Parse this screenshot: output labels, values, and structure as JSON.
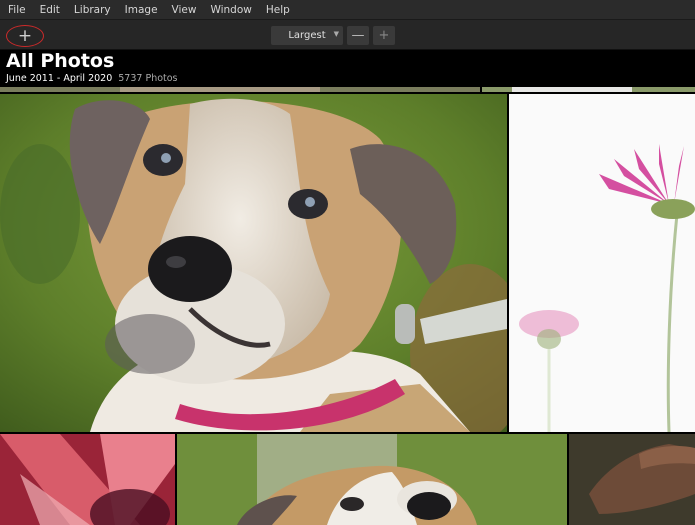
{
  "menu": [
    "File",
    "Edit",
    "Library",
    "Image",
    "View",
    "Window",
    "Help"
  ],
  "toolbar": {
    "add_label": "+",
    "size_value": "Largest",
    "zoom_out": "—",
    "zoom_in": "+"
  },
  "header": {
    "title": "All Photos",
    "date_range": "June 2011 - April 2020",
    "count": "5737 Photos"
  },
  "colors": {
    "accent_circle": "#cc2a2a",
    "menubar": "#2b2b2b",
    "toolbar": "#262626"
  }
}
